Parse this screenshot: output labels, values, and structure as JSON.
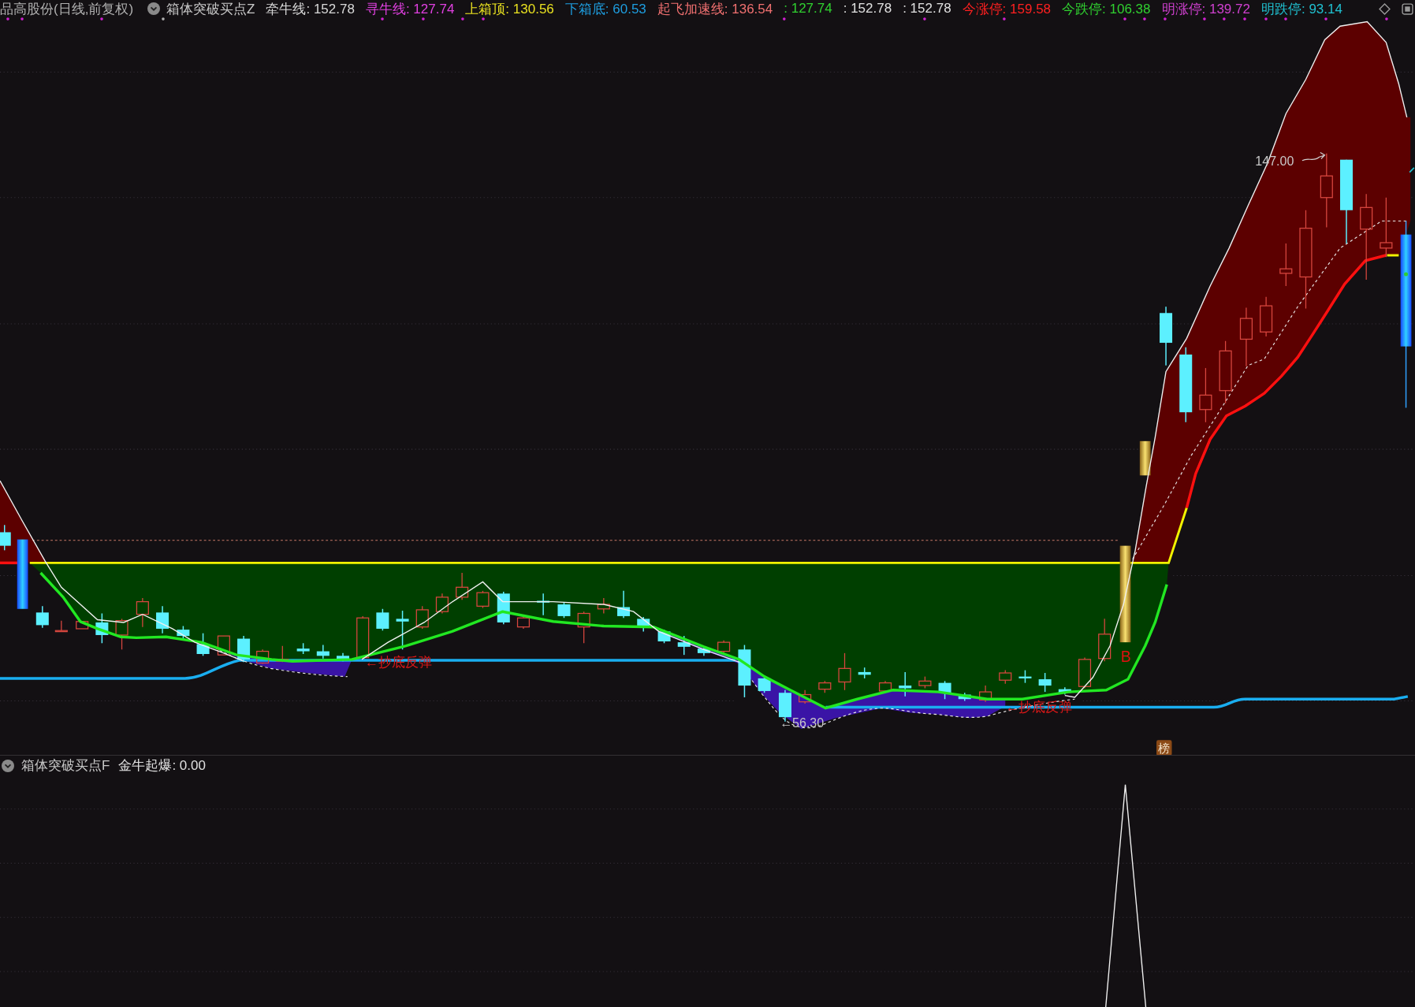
{
  "header": {
    "title": "品高股份(日线,前复权)",
    "indicator": "箱体突破买点Z",
    "values": [
      {
        "text": "牵牛线: 152.78",
        "color": "#d8d8d8"
      },
      {
        "text": "寻牛线: 127.74",
        "color": "#e040e0"
      },
      {
        "text": "上箱顶: 130.56",
        "color": "#e8e020"
      },
      {
        "text": "下箱底: 60.53",
        "color": "#1e9ee0"
      },
      {
        "text": "起飞加速线: 136.54",
        "color": "#f07070"
      },
      {
        "text": ": 127.74",
        "color": "#30d030"
      },
      {
        "text": ": 152.78",
        "color": "#e0e0e0"
      },
      {
        "text": ": 152.78",
        "color": "#e0e0e0"
      },
      {
        "text": "今涨停: 159.58",
        "color": "#ff2020"
      },
      {
        "text": "今跌停: 106.38",
        "color": "#30d030"
      },
      {
        "text": "明涨停: 139.72",
        "color": "#d040d0"
      },
      {
        "text": "明跌停: 93.14",
        "color": "#20c0d0"
      }
    ]
  },
  "main_chart": {
    "labels": [
      {
        "kind": "price",
        "text": "147.00"
      },
      {
        "kind": "price",
        "text": "←56.30"
      },
      {
        "kind": "signal",
        "text": "←抄底反弹"
      },
      {
        "kind": "signal",
        "text": "←抄底反弹"
      },
      {
        "kind": "buy",
        "text": "B"
      },
      {
        "kind": "badge",
        "text": "榜"
      }
    ]
  },
  "lower_panel": {
    "indicator": "箱体突破买点F",
    "values": [
      {
        "text": "金牛起爆: 0.00"
      }
    ]
  }
}
